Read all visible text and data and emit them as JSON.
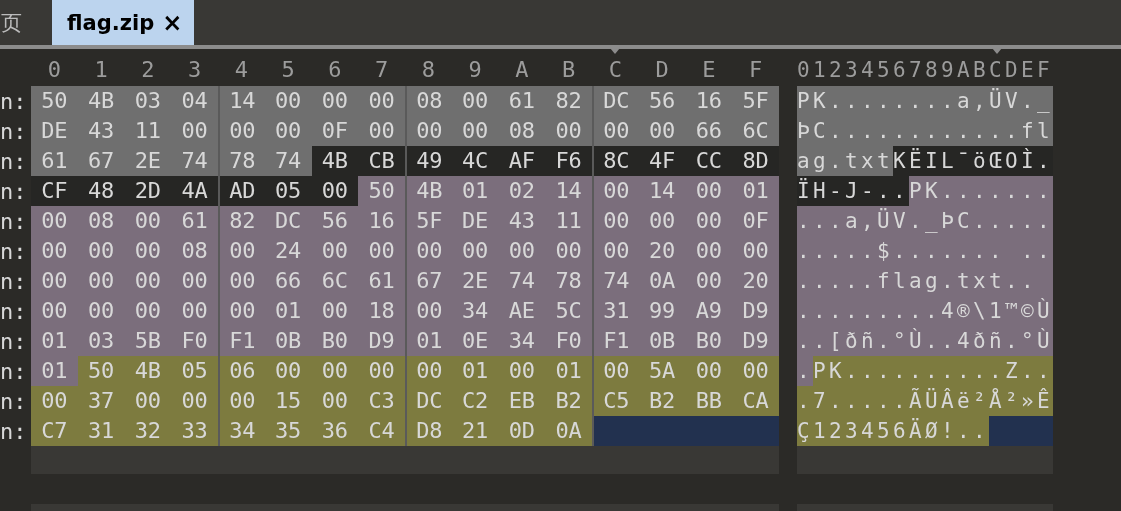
{
  "tabs": [
    {
      "label": "页",
      "selected": false
    },
    {
      "label": "flag.zip",
      "selected": true,
      "close": "×"
    }
  ],
  "hex_view": {
    "column_headers": [
      "0",
      "1",
      "2",
      "3",
      "4",
      "5",
      "6",
      "7",
      "8",
      "9",
      "A",
      "B",
      "C",
      "D",
      "E",
      "F"
    ],
    "ascii_header": "0123456789ABCDEF",
    "rows": [
      {
        "address": "n:",
        "spans": [
          {
            "kind": "bytes",
            "color": "#6f6f6f",
            "bytes": [
              "50",
              "4B",
              "03",
              "04",
              "14",
              "00",
              "00",
              "00",
              "08",
              "00",
              "61",
              "82",
              "DC",
              "56",
              "16",
              "5F"
            ],
            "text": "PK........a,ÜV._"
          }
        ]
      },
      {
        "address": "n:",
        "spans": [
          {
            "kind": "bytes",
            "color": "#6f6f6f",
            "bytes": [
              "DE",
              "43",
              "11",
              "00",
              "00",
              "00",
              "0F",
              "00",
              "00",
              "00",
              "08",
              "00",
              "00",
              "00",
              "66",
              "6C"
            ],
            "text": "ÞC............fl"
          }
        ]
      },
      {
        "address": "n:",
        "spans": [
          {
            "kind": "bytes",
            "color": "#6f6f6f",
            "bytes": [
              "61",
              "67",
              "2E",
              "74",
              "78",
              "74"
            ],
            "text": "ag.txt"
          },
          {
            "kind": "bytes",
            "color": "#262624",
            "bytes": [
              "4B",
              "CB",
              "49",
              "4C",
              "AF",
              "F6",
              "8C",
              "4F",
              "CC",
              "8D"
            ],
            "text": "KËIL¯öŒOÌ."
          }
        ]
      },
      {
        "address": "n:",
        "spans": [
          {
            "kind": "bytes",
            "color": "#262624",
            "bytes": [
              "CF",
              "48",
              "2D",
              "4A",
              "AD",
              "05",
              "00"
            ],
            "text": "ÏH-J-.."
          },
          {
            "kind": "bytes",
            "color": "#7b6e7c",
            "bytes": [
              "50",
              "4B",
              "01",
              "02",
              "14",
              "00",
              "14",
              "00",
              "01"
            ],
            "text": "PK......."
          }
        ]
      },
      {
        "address": "n:",
        "spans": [
          {
            "kind": "bytes",
            "color": "#7b6e7c",
            "bytes": [
              "00",
              "08",
              "00",
              "61",
              "82",
              "DC",
              "56",
              "16",
              "5F",
              "DE",
              "43",
              "11",
              "00",
              "00",
              "00",
              "0F"
            ],
            "text": "...a,ÜV._ÞC....."
          }
        ]
      },
      {
        "address": "n:",
        "spans": [
          {
            "kind": "bytes",
            "color": "#7b6e7c",
            "bytes": [
              "00",
              "00",
              "00",
              "08",
              "00",
              "24",
              "00",
              "00",
              "00",
              "00",
              "00",
              "00",
              "00",
              "20",
              "00",
              "00"
            ],
            "text": ".....$....... .."
          }
        ]
      },
      {
        "address": "n:",
        "spans": [
          {
            "kind": "bytes",
            "color": "#7b6e7c",
            "bytes": [
              "00",
              "00",
              "00",
              "00",
              "00",
              "66",
              "6C",
              "61",
              "67",
              "2E",
              "74",
              "78",
              "74",
              "0A",
              "00",
              "20"
            ],
            "text": ".....flag.txt.. "
          }
        ]
      },
      {
        "address": "n:",
        "spans": [
          {
            "kind": "bytes",
            "color": "#7b6e7c",
            "bytes": [
              "00",
              "00",
              "00",
              "00",
              "00",
              "01",
              "00",
              "18",
              "00",
              "34",
              "AE",
              "5C",
              "31",
              "99",
              "A9",
              "D9"
            ],
            "text": ".........4®\\1™©Ù"
          }
        ]
      },
      {
        "address": "n:",
        "spans": [
          {
            "kind": "bytes",
            "color": "#7b6e7c",
            "bytes": [
              "01",
              "03",
              "5B",
              "F0",
              "F1",
              "0B",
              "B0",
              "D9",
              "01",
              "0E",
              "34",
              "F0",
              "F1",
              "0B",
              "B0",
              "D9"
            ],
            "text": "..[ðñ.°Ù..4ðñ.°Ù"
          }
        ]
      },
      {
        "address": "n:",
        "spans": [
          {
            "kind": "bytes",
            "color": "#7b6e7c",
            "bytes": [
              "01"
            ],
            "text": "."
          },
          {
            "kind": "bytes",
            "color": "#7d7b3f",
            "bytes": [
              "50",
              "4B",
              "05",
              "06",
              "00",
              "00",
              "00",
              "00",
              "01",
              "00",
              "01",
              "00",
              "5A",
              "00",
              "00"
            ],
            "text": "PK..........Z.."
          }
        ]
      },
      {
        "address": "n:",
        "spans": [
          {
            "kind": "bytes",
            "color": "#7d7b3f",
            "bytes": [
              "00",
              "37",
              "00",
              "00",
              "00",
              "15",
              "00",
              "C3",
              "DC",
              "C2",
              "EB",
              "B2",
              "C5",
              "B2",
              "BB",
              "CA"
            ],
            "text": ".7.....ÃÜÂë²Å²»Ê"
          }
        ]
      },
      {
        "address": "n:",
        "spans": [
          {
            "kind": "bytes",
            "color": "#7d7b3f",
            "bytes": [
              "C7",
              "31",
              "32",
              "33",
              "34",
              "35",
              "36",
              "C4",
              "D8",
              "21",
              "0D",
              "0A"
            ],
            "text": "Ç123456ÄØ!.."
          },
          {
            "kind": "empty",
            "color": "#22314f"
          }
        ]
      }
    ]
  }
}
